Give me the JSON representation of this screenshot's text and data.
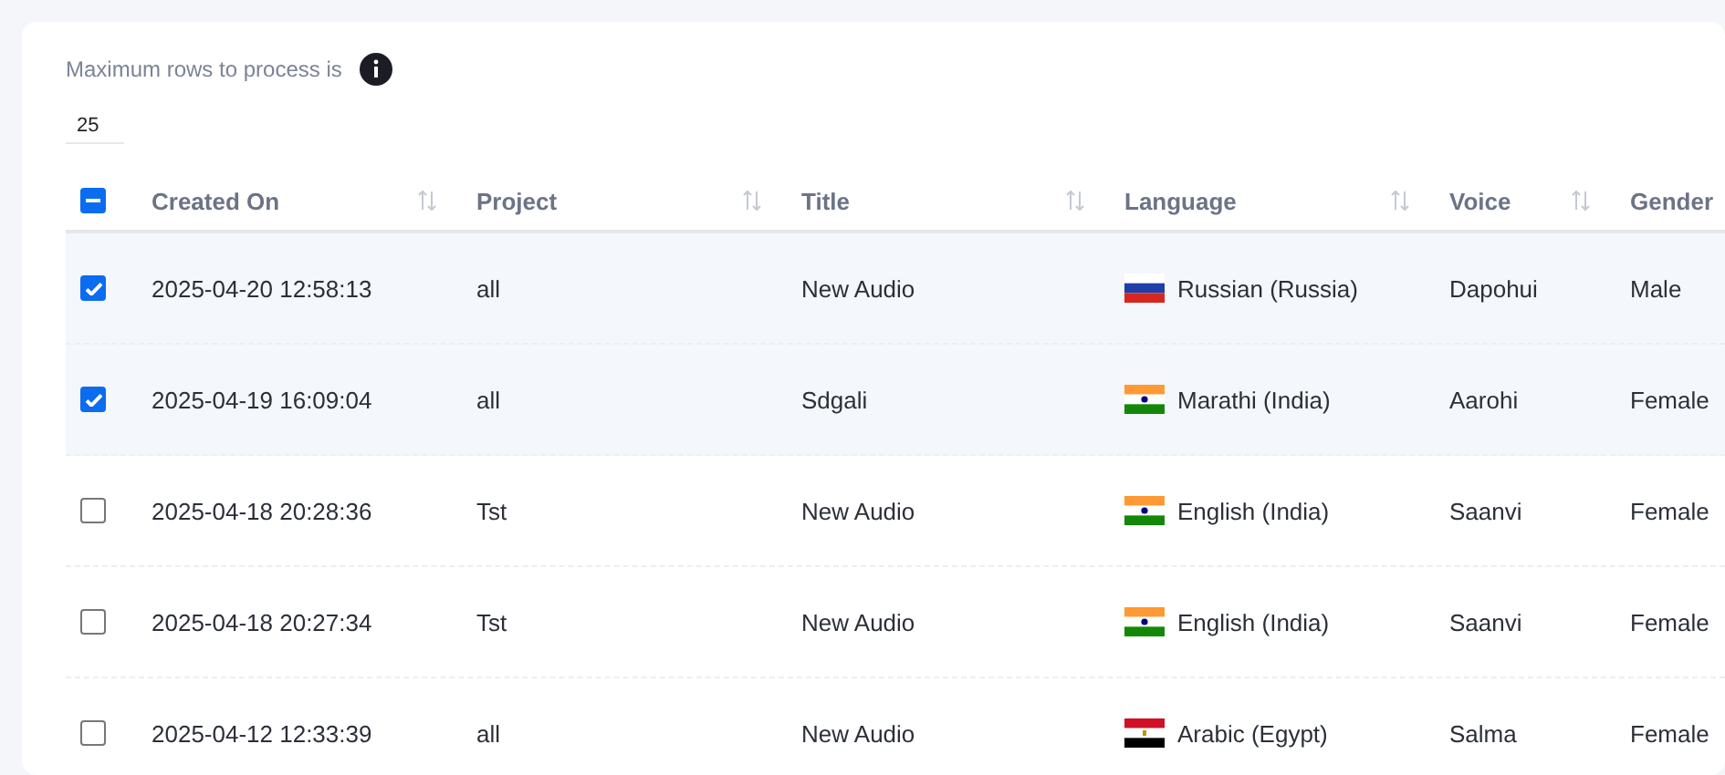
{
  "limit": {
    "label": "Maximum rows to process is",
    "value": "25"
  },
  "table": {
    "select_all": {
      "indeterminate": true
    },
    "columns": [
      {
        "label": "Created On",
        "sortable": true
      },
      {
        "label": "Project",
        "sortable": true
      },
      {
        "label": "Title",
        "sortable": true
      },
      {
        "label": "Language",
        "sortable": true
      },
      {
        "label": "Voice",
        "sortable": true
      },
      {
        "label": "Gender",
        "sortable": false
      }
    ],
    "rows": [
      {
        "selected": true,
        "created_on": "2025-04-20 12:58:13",
        "project": "all",
        "title": "New Audio",
        "language": {
          "kind": "ru",
          "label": "Russian (Russia)"
        },
        "voice": "Dapohui",
        "gender": "Male"
      },
      {
        "selected": true,
        "created_on": "2025-04-19 16:09:04",
        "project": "all",
        "title": "Sdgali",
        "language": {
          "kind": "in",
          "label": "Marathi (India)"
        },
        "voice": "Aarohi",
        "gender": "Female"
      },
      {
        "selected": false,
        "created_on": "2025-04-18 20:28:36",
        "project": "Tst",
        "title": "New Audio",
        "language": {
          "kind": "in",
          "label": "English (India)"
        },
        "voice": "Saanvi",
        "gender": "Female"
      },
      {
        "selected": false,
        "created_on": "2025-04-18 20:27:34",
        "project": "Tst",
        "title": "New Audio",
        "language": {
          "kind": "in",
          "label": "English (India)"
        },
        "voice": "Saanvi",
        "gender": "Female"
      },
      {
        "selected": false,
        "created_on": "2025-04-12 12:33:39",
        "project": "all",
        "title": "New Audio",
        "language": {
          "kind": "eg",
          "label": "Arabic (Egypt)"
        },
        "voice": "Salma",
        "gender": "Female"
      }
    ]
  }
}
